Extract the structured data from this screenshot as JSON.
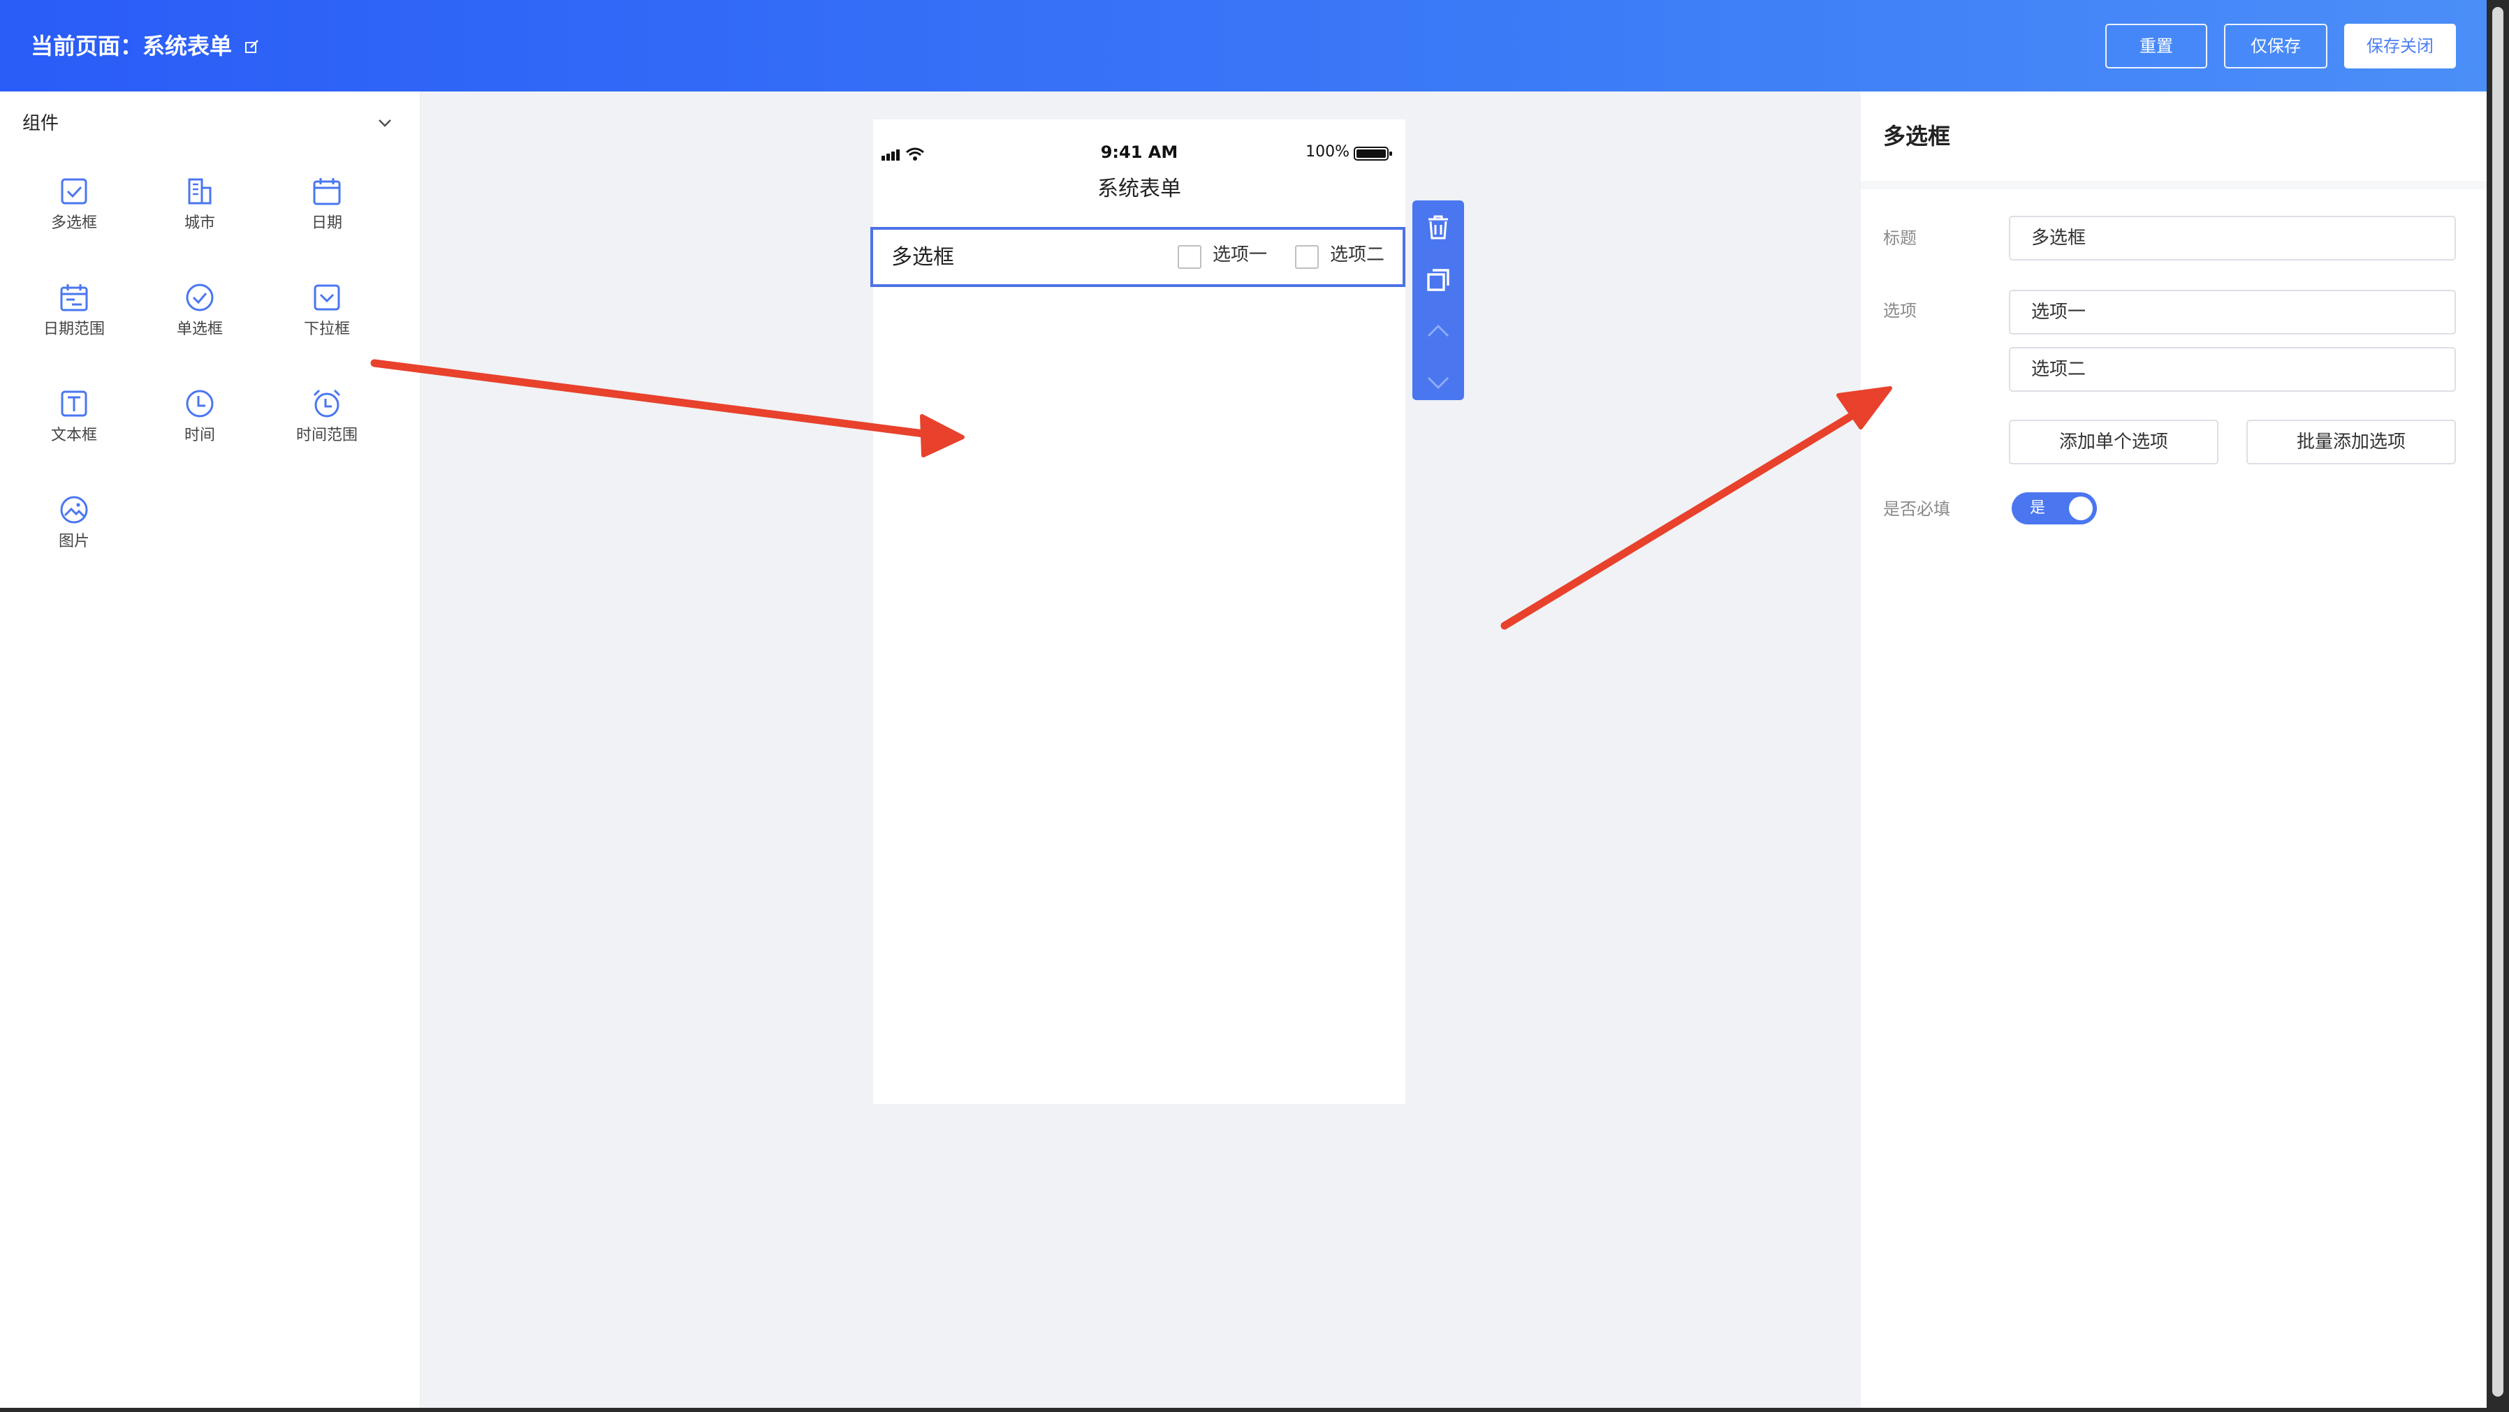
{
  "header": {
    "title": "当前页面：系统表单",
    "buttons": {
      "reset": "重置",
      "save_only": "仅保存",
      "save_close": "保存关闭"
    }
  },
  "left_panel": {
    "title": "组件",
    "components": [
      {
        "label": "多选框",
        "icon": "checkbox-icon"
      },
      {
        "label": "城市",
        "icon": "building-icon"
      },
      {
        "label": "日期",
        "icon": "calendar-icon"
      },
      {
        "label": "日期范围",
        "icon": "calendar-range-icon"
      },
      {
        "label": "单选框",
        "icon": "radio-check-icon"
      },
      {
        "label": "下拉框",
        "icon": "dropdown-icon"
      },
      {
        "label": "文本框",
        "icon": "text-icon"
      },
      {
        "label": "时间",
        "icon": "clock-icon"
      },
      {
        "label": "时间范围",
        "icon": "alarm-clock-icon"
      },
      {
        "label": "图片",
        "icon": "image-icon"
      }
    ]
  },
  "phone": {
    "status_time": "9:41 AM",
    "battery": "100%",
    "title": "系统表单",
    "field": {
      "label": "多选框",
      "options": [
        "选项一",
        "选项二"
      ]
    }
  },
  "right_panel": {
    "title": "多选框",
    "title_label": "标题",
    "title_value": "多选框",
    "options_label": "选项",
    "options": [
      "选项一",
      "选项二"
    ],
    "add_single": "添加单个选项",
    "add_batch": "批量添加选项",
    "required_label": "是否必填",
    "required_toggle_text": "是"
  },
  "colors": {
    "accent": "#4a76f0",
    "annotation_arrow": "#e8412c"
  }
}
